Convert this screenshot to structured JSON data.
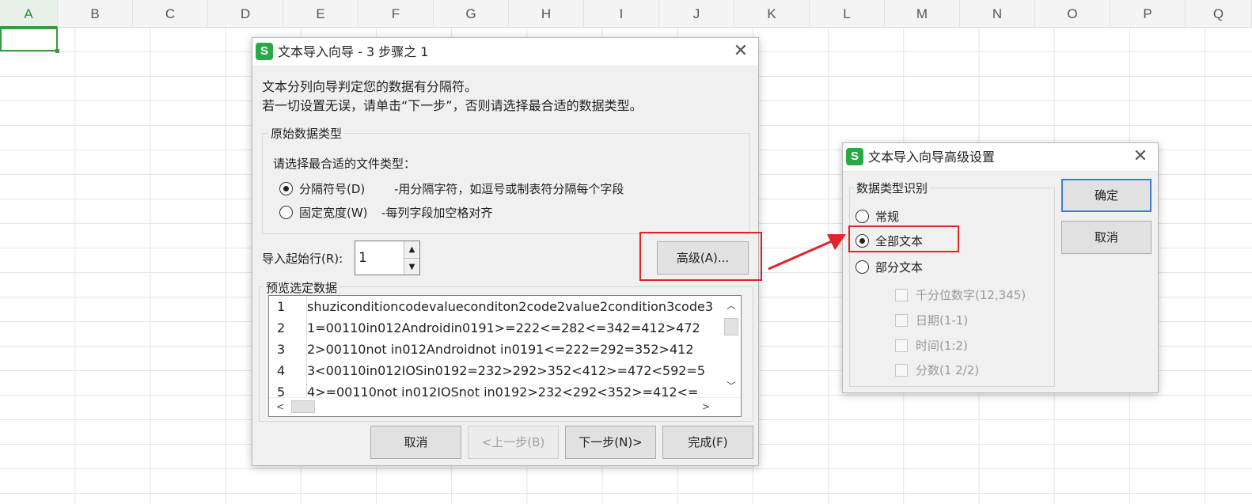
{
  "spreadsheet": {
    "columns": [
      "A",
      "B",
      "C",
      "D",
      "E",
      "F",
      "G",
      "H",
      "I",
      "J",
      "K",
      "L",
      "M",
      "N",
      "O",
      "P",
      "Q"
    ],
    "active_column": "A"
  },
  "wizard": {
    "app_icon": "S",
    "title": "文本导入向导 - 3 步骤之 1",
    "intro_line1": "文本分列向导判定您的数据有分隔符。",
    "intro_line2": "若一切设置无误，请单击“下一步”，否则请选择最合适的数据类型。",
    "group_title": "原始数据类型",
    "prompt": "请选择最合适的文件类型：",
    "options": [
      {
        "label": "分隔符号(D)",
        "desc": "-用分隔字符，如逗号或制表符分隔每个字段",
        "checked": true
      },
      {
        "label": "固定宽度(W)",
        "desc": "-每列字段加空格对齐",
        "checked": false
      }
    ],
    "start_row_label": "导入起始行(R):",
    "start_row_value": "1",
    "advanced_button": "高级(A)...",
    "preview_title": "预览选定数据",
    "preview_rows": [
      {
        "num": "1",
        "text": "shuziconditioncodevalueconditon2code2value2condition3code3"
      },
      {
        "num": "2",
        "text": "1=00110in012Androidin0191>=222<=282<=342=412>472"
      },
      {
        "num": "3",
        "text": "2>00110not in012Androidnot in0191<=222=292=352>412"
      },
      {
        "num": "4",
        "text": "3<00110in012IOSin0192=232>292>352<412>=472<592=5"
      },
      {
        "num": "5",
        "text": "4>=00110not in012IOSnot in0192>232<292<352>=412<="
      }
    ],
    "buttons": {
      "cancel": "取消",
      "prev": "<上一步(B)",
      "next": "下一步(N)>",
      "finish": "完成(F)"
    }
  },
  "advanced": {
    "app_icon": "S",
    "title": "文本导入向导高级设置",
    "group_title": "数据类型识别",
    "options": [
      {
        "label": "常规",
        "checked": false
      },
      {
        "label": "全部文本",
        "checked": true
      },
      {
        "label": "部分文本",
        "checked": false
      }
    ],
    "sub_options": [
      {
        "label": "千分位数字(12,345)",
        "checked": false
      },
      {
        "label": "日期(1-1)",
        "checked": false
      },
      {
        "label": "时间(1:2)",
        "checked": false
      },
      {
        "label": "分数(1 2/2)",
        "checked": false
      }
    ],
    "ok_button": "确定",
    "cancel_button": "取消"
  },
  "annotation_color": "#e0242a"
}
